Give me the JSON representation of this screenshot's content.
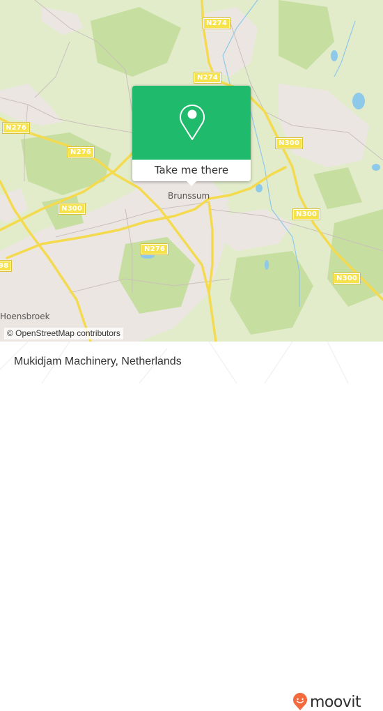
{
  "map": {
    "road_labels": [
      {
        "id": "n274-top",
        "text": "N274"
      },
      {
        "id": "n274-mid",
        "text": "N274"
      },
      {
        "id": "n276-left",
        "text": "N276"
      },
      {
        "id": "n276-center",
        "text": "N276"
      },
      {
        "id": "n276-bottom",
        "text": "N276"
      },
      {
        "id": "n300-left",
        "text": "N300"
      },
      {
        "id": "n300-right-top",
        "text": "N300"
      },
      {
        "id": "n300-right-mid",
        "text": "N300"
      },
      {
        "id": "n300-right-bottom",
        "text": "N300"
      },
      {
        "id": "n298-edge",
        "text": "98"
      }
    ],
    "place_labels": {
      "brunssum": "Brunssum",
      "hoensbroek": "Hoensbroek"
    },
    "attribution": "© OpenStreetMap contributors",
    "colors": {
      "land": "#e2eccb",
      "urban": "#ece6e3",
      "forest": "#c6dea0",
      "water": "#8ec9ea",
      "road": "#f4da4e"
    }
  },
  "popup": {
    "icon": "map-pin-icon",
    "button_label": "Take me there",
    "color": "#1fba6c"
  },
  "footer": {
    "title": "Mukidjam Machinery, Netherlands",
    "brand": "moovit",
    "brand_color": "#f26a3d"
  }
}
